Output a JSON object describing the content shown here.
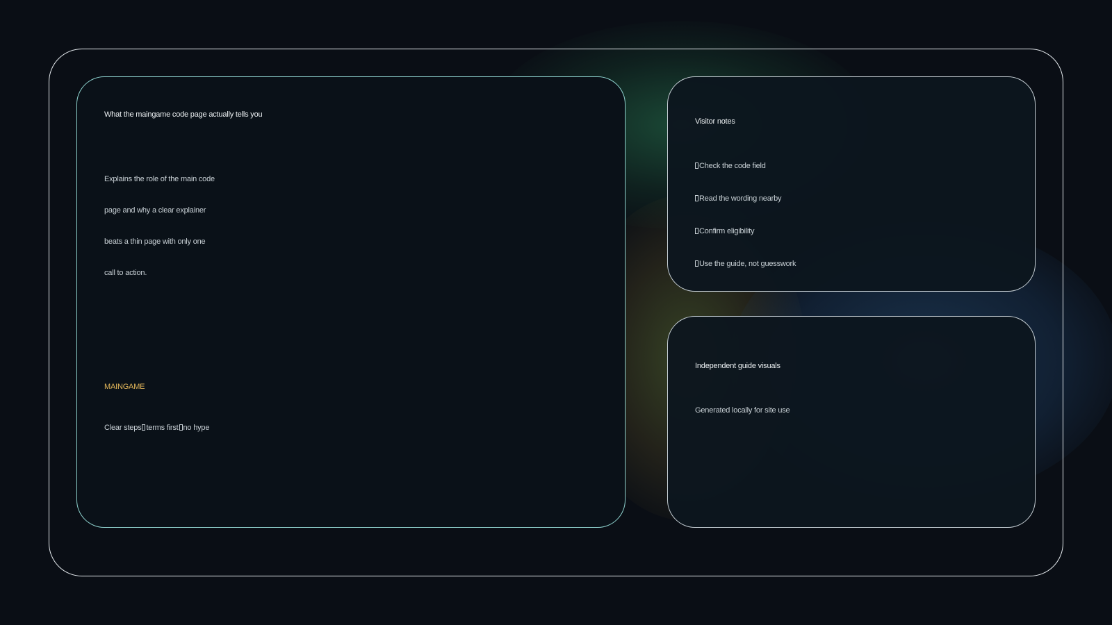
{
  "main_card": {
    "title": "What the maingame code page actually tells you",
    "description_lines": [
      "Explains the role of the main code",
      "page and why a clear explainer",
      "beats a thin page with only one",
      "call to action."
    ],
    "brand": "MAINGAME",
    "tagline_parts": [
      "Clear steps",
      "terms first",
      "no hype"
    ]
  },
  "notes_card": {
    "title": "Visitor notes",
    "items": [
      "Check the code field",
      "Read the wording nearby",
      "Confirm eligibility",
      "Use the guide, not guesswork"
    ]
  },
  "visuals_card": {
    "title": "Independent guide visuals",
    "caption": "Generated locally for site use"
  },
  "colors": {
    "background": "#0a0e15",
    "main_card_border": "#8fd3cf",
    "accent": "#e2b65a"
  }
}
